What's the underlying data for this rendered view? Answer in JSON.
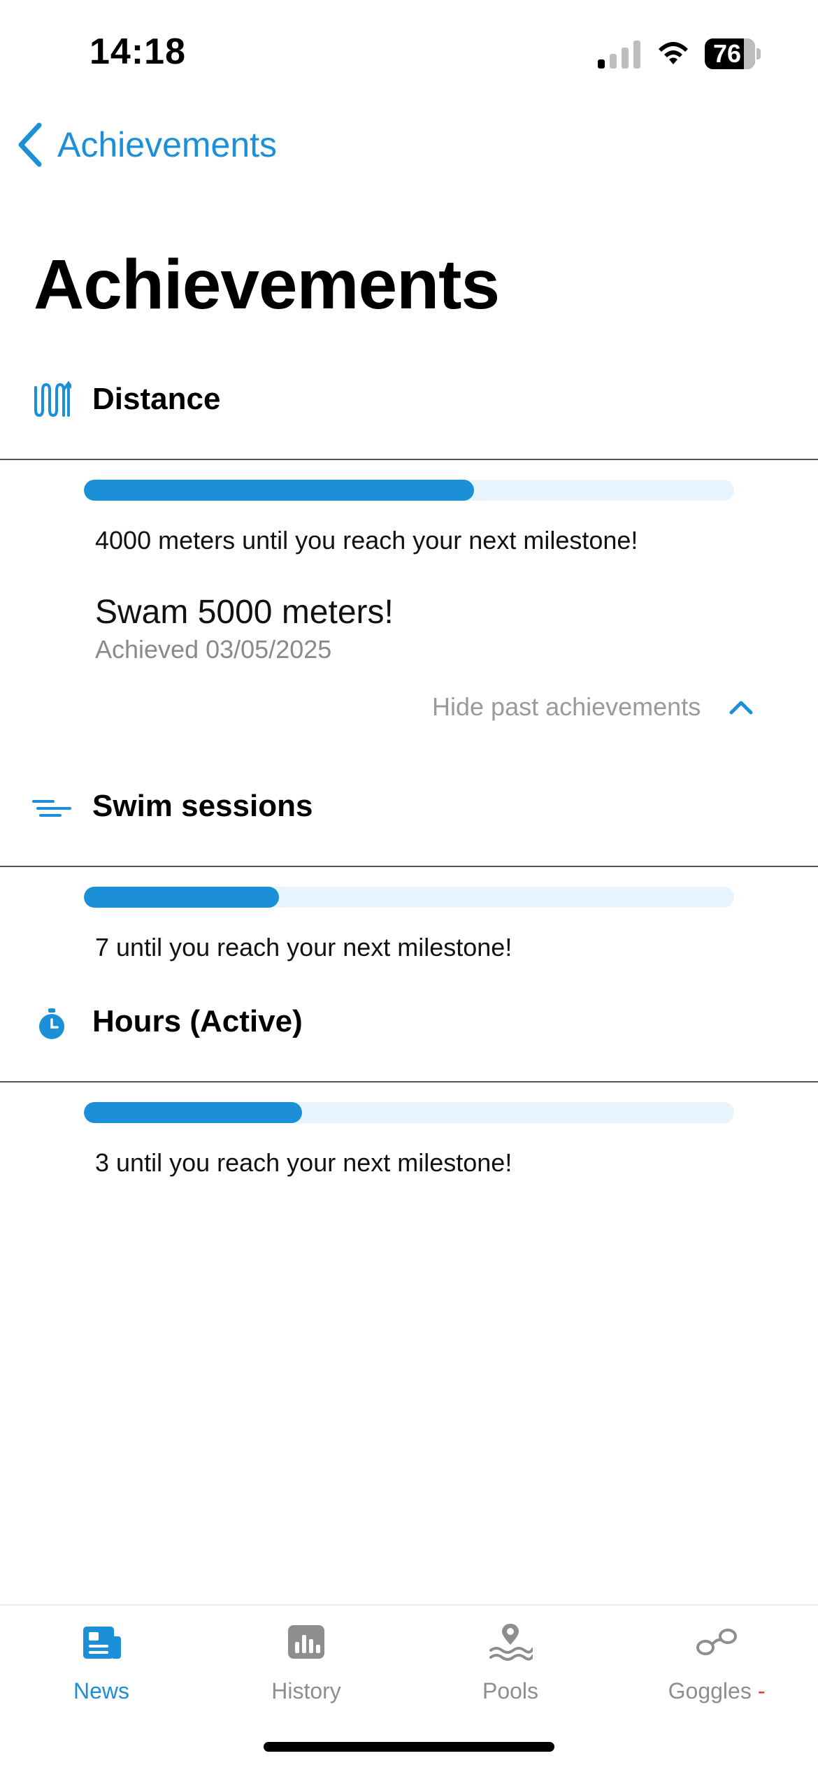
{
  "status_bar": {
    "time": "14:18",
    "battery": "76"
  },
  "nav": {
    "back_label": "Achievements"
  },
  "page": {
    "title": "Achievements"
  },
  "sections": [
    {
      "title": "Distance",
      "icon": "distance-icon",
      "progress": 0.6,
      "message": "4000 meters until you reach your next milestone!",
      "past_achievement": {
        "title": "Swam 5000 meters!",
        "date": "Achieved 03/05/2025"
      },
      "toggle_label": "Hide past achievements"
    },
    {
      "title": "Swim sessions",
      "icon": "swim-sessions-icon",
      "progress": 0.3,
      "message": "7 until you reach your next milestone!"
    },
    {
      "title": "Hours (Active)",
      "icon": "stopwatch-icon",
      "progress": 0.335,
      "message": "3 until you reach your next milestone!"
    }
  ],
  "tabbar": {
    "tabs": [
      {
        "label": "News",
        "icon": "newspaper-icon",
        "active": true
      },
      {
        "label": "History",
        "icon": "chart-icon",
        "active": false
      },
      {
        "label": "Pools",
        "icon": "pool-location-icon",
        "active": false
      },
      {
        "label": "Goggles",
        "icon": "goggles-icon",
        "active": false,
        "badge": "-"
      }
    ]
  },
  "colors": {
    "accent": "#1b8fd8",
    "track": "#e8f4fd",
    "muted": "#8e8e8e",
    "badge": "#e53935"
  }
}
